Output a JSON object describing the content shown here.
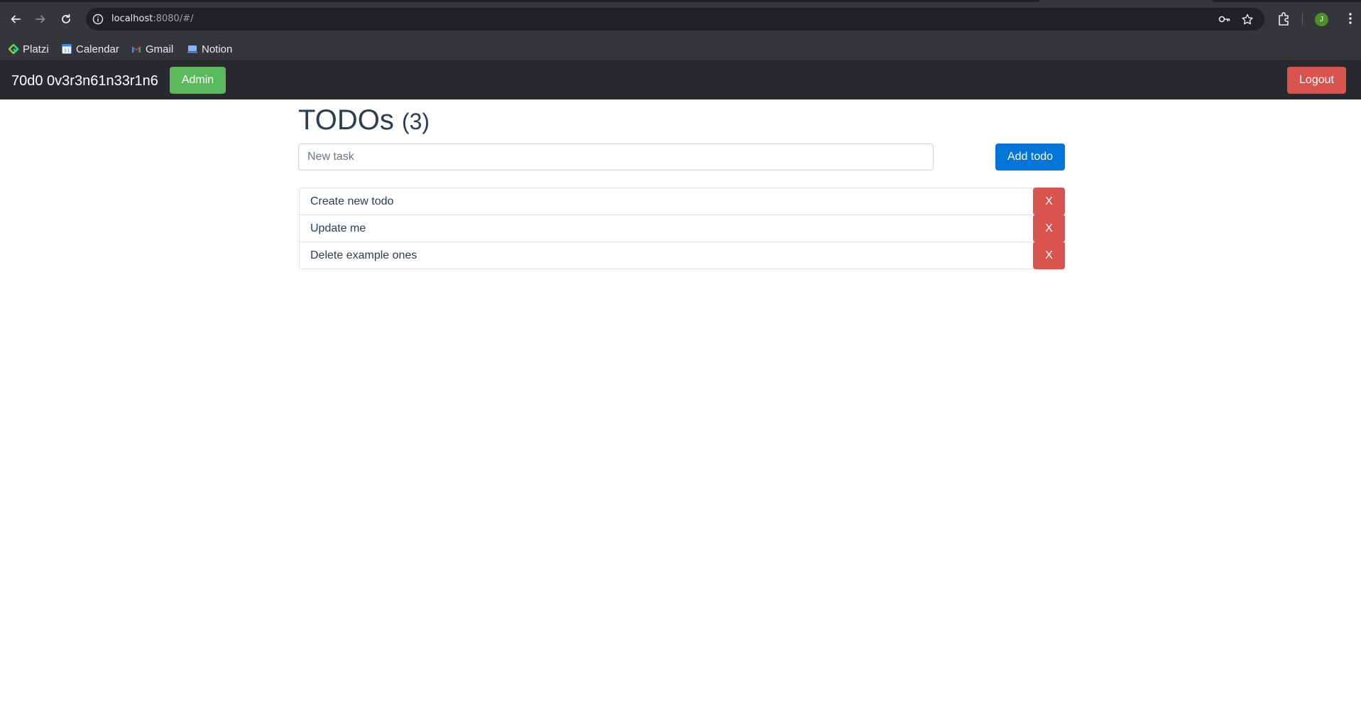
{
  "browser": {
    "url_host": "localhost",
    "url_path": ":8080/#/",
    "profile_initial": "J",
    "bookmarks": [
      {
        "label": "Platzi",
        "icon": "platzi-icon"
      },
      {
        "label": "Calendar",
        "icon": "calendar-icon"
      },
      {
        "label": "Gmail",
        "icon": "gmail-icon"
      },
      {
        "label": "Notion",
        "icon": "notion-icon"
      }
    ]
  },
  "navbar": {
    "brand": "70d0 0v3r3n61n33r1n6",
    "admin_label": "Admin",
    "logout_label": "Logout"
  },
  "main": {
    "title": "TODOs",
    "count": "(3)",
    "input_placeholder": "New task",
    "input_value": "",
    "add_label": "Add todo",
    "todos": [
      {
        "text": "Create new todo",
        "delete_label": "X"
      },
      {
        "text": "Update me",
        "delete_label": "X"
      },
      {
        "text": "Delete example ones",
        "delete_label": "X"
      }
    ]
  },
  "colors": {
    "admin": "#5cb85c",
    "danger": "#d9534f",
    "primary": "#0275d8",
    "navbar": "#27292c",
    "title": "#2c3e50"
  }
}
